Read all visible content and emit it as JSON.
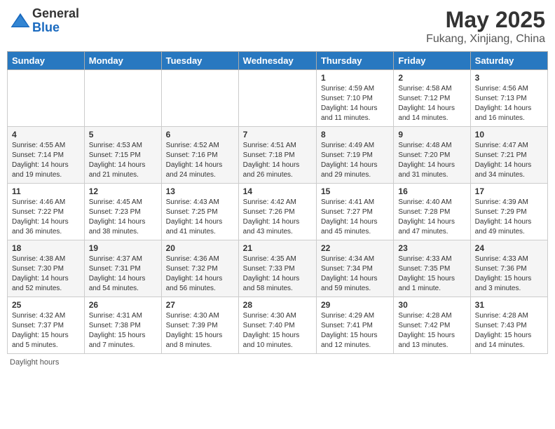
{
  "header": {
    "logo_general": "General",
    "logo_blue": "Blue",
    "month": "May 2025",
    "location": "Fukang, Xinjiang, China"
  },
  "weekdays": [
    "Sunday",
    "Monday",
    "Tuesday",
    "Wednesday",
    "Thursday",
    "Friday",
    "Saturday"
  ],
  "footer": "Daylight hours",
  "weeks": [
    [
      {
        "day": "",
        "sunrise": "",
        "sunset": "",
        "daylight": ""
      },
      {
        "day": "",
        "sunrise": "",
        "sunset": "",
        "daylight": ""
      },
      {
        "day": "",
        "sunrise": "",
        "sunset": "",
        "daylight": ""
      },
      {
        "day": "",
        "sunrise": "",
        "sunset": "",
        "daylight": ""
      },
      {
        "day": "1",
        "sunrise": "Sunrise: 4:59 AM",
        "sunset": "Sunset: 7:10 PM",
        "daylight": "Daylight: 14 hours and 11 minutes."
      },
      {
        "day": "2",
        "sunrise": "Sunrise: 4:58 AM",
        "sunset": "Sunset: 7:12 PM",
        "daylight": "Daylight: 14 hours and 14 minutes."
      },
      {
        "day": "3",
        "sunrise": "Sunrise: 4:56 AM",
        "sunset": "Sunset: 7:13 PM",
        "daylight": "Daylight: 14 hours and 16 minutes."
      }
    ],
    [
      {
        "day": "4",
        "sunrise": "Sunrise: 4:55 AM",
        "sunset": "Sunset: 7:14 PM",
        "daylight": "Daylight: 14 hours and 19 minutes."
      },
      {
        "day": "5",
        "sunrise": "Sunrise: 4:53 AM",
        "sunset": "Sunset: 7:15 PM",
        "daylight": "Daylight: 14 hours and 21 minutes."
      },
      {
        "day": "6",
        "sunrise": "Sunrise: 4:52 AM",
        "sunset": "Sunset: 7:16 PM",
        "daylight": "Daylight: 14 hours and 24 minutes."
      },
      {
        "day": "7",
        "sunrise": "Sunrise: 4:51 AM",
        "sunset": "Sunset: 7:18 PM",
        "daylight": "Daylight: 14 hours and 26 minutes."
      },
      {
        "day": "8",
        "sunrise": "Sunrise: 4:49 AM",
        "sunset": "Sunset: 7:19 PM",
        "daylight": "Daylight: 14 hours and 29 minutes."
      },
      {
        "day": "9",
        "sunrise": "Sunrise: 4:48 AM",
        "sunset": "Sunset: 7:20 PM",
        "daylight": "Daylight: 14 hours and 31 minutes."
      },
      {
        "day": "10",
        "sunrise": "Sunrise: 4:47 AM",
        "sunset": "Sunset: 7:21 PM",
        "daylight": "Daylight: 14 hours and 34 minutes."
      }
    ],
    [
      {
        "day": "11",
        "sunrise": "Sunrise: 4:46 AM",
        "sunset": "Sunset: 7:22 PM",
        "daylight": "Daylight: 14 hours and 36 minutes."
      },
      {
        "day": "12",
        "sunrise": "Sunrise: 4:45 AM",
        "sunset": "Sunset: 7:23 PM",
        "daylight": "Daylight: 14 hours and 38 minutes."
      },
      {
        "day": "13",
        "sunrise": "Sunrise: 4:43 AM",
        "sunset": "Sunset: 7:25 PM",
        "daylight": "Daylight: 14 hours and 41 minutes."
      },
      {
        "day": "14",
        "sunrise": "Sunrise: 4:42 AM",
        "sunset": "Sunset: 7:26 PM",
        "daylight": "Daylight: 14 hours and 43 minutes."
      },
      {
        "day": "15",
        "sunrise": "Sunrise: 4:41 AM",
        "sunset": "Sunset: 7:27 PM",
        "daylight": "Daylight: 14 hours and 45 minutes."
      },
      {
        "day": "16",
        "sunrise": "Sunrise: 4:40 AM",
        "sunset": "Sunset: 7:28 PM",
        "daylight": "Daylight: 14 hours and 47 minutes."
      },
      {
        "day": "17",
        "sunrise": "Sunrise: 4:39 AM",
        "sunset": "Sunset: 7:29 PM",
        "daylight": "Daylight: 14 hours and 49 minutes."
      }
    ],
    [
      {
        "day": "18",
        "sunrise": "Sunrise: 4:38 AM",
        "sunset": "Sunset: 7:30 PM",
        "daylight": "Daylight: 14 hours and 52 minutes."
      },
      {
        "day": "19",
        "sunrise": "Sunrise: 4:37 AM",
        "sunset": "Sunset: 7:31 PM",
        "daylight": "Daylight: 14 hours and 54 minutes."
      },
      {
        "day": "20",
        "sunrise": "Sunrise: 4:36 AM",
        "sunset": "Sunset: 7:32 PM",
        "daylight": "Daylight: 14 hours and 56 minutes."
      },
      {
        "day": "21",
        "sunrise": "Sunrise: 4:35 AM",
        "sunset": "Sunset: 7:33 PM",
        "daylight": "Daylight: 14 hours and 58 minutes."
      },
      {
        "day": "22",
        "sunrise": "Sunrise: 4:34 AM",
        "sunset": "Sunset: 7:34 PM",
        "daylight": "Daylight: 14 hours and 59 minutes."
      },
      {
        "day": "23",
        "sunrise": "Sunrise: 4:33 AM",
        "sunset": "Sunset: 7:35 PM",
        "daylight": "Daylight: 15 hours and 1 minute."
      },
      {
        "day": "24",
        "sunrise": "Sunrise: 4:33 AM",
        "sunset": "Sunset: 7:36 PM",
        "daylight": "Daylight: 15 hours and 3 minutes."
      }
    ],
    [
      {
        "day": "25",
        "sunrise": "Sunrise: 4:32 AM",
        "sunset": "Sunset: 7:37 PM",
        "daylight": "Daylight: 15 hours and 5 minutes."
      },
      {
        "day": "26",
        "sunrise": "Sunrise: 4:31 AM",
        "sunset": "Sunset: 7:38 PM",
        "daylight": "Daylight: 15 hours and 7 minutes."
      },
      {
        "day": "27",
        "sunrise": "Sunrise: 4:30 AM",
        "sunset": "Sunset: 7:39 PM",
        "daylight": "Daylight: 15 hours and 8 minutes."
      },
      {
        "day": "28",
        "sunrise": "Sunrise: 4:30 AM",
        "sunset": "Sunset: 7:40 PM",
        "daylight": "Daylight: 15 hours and 10 minutes."
      },
      {
        "day": "29",
        "sunrise": "Sunrise: 4:29 AM",
        "sunset": "Sunset: 7:41 PM",
        "daylight": "Daylight: 15 hours and 12 minutes."
      },
      {
        "day": "30",
        "sunrise": "Sunrise: 4:28 AM",
        "sunset": "Sunset: 7:42 PM",
        "daylight": "Daylight: 15 hours and 13 minutes."
      },
      {
        "day": "31",
        "sunrise": "Sunrise: 4:28 AM",
        "sunset": "Sunset: 7:43 PM",
        "daylight": "Daylight: 15 hours and 14 minutes."
      }
    ]
  ]
}
